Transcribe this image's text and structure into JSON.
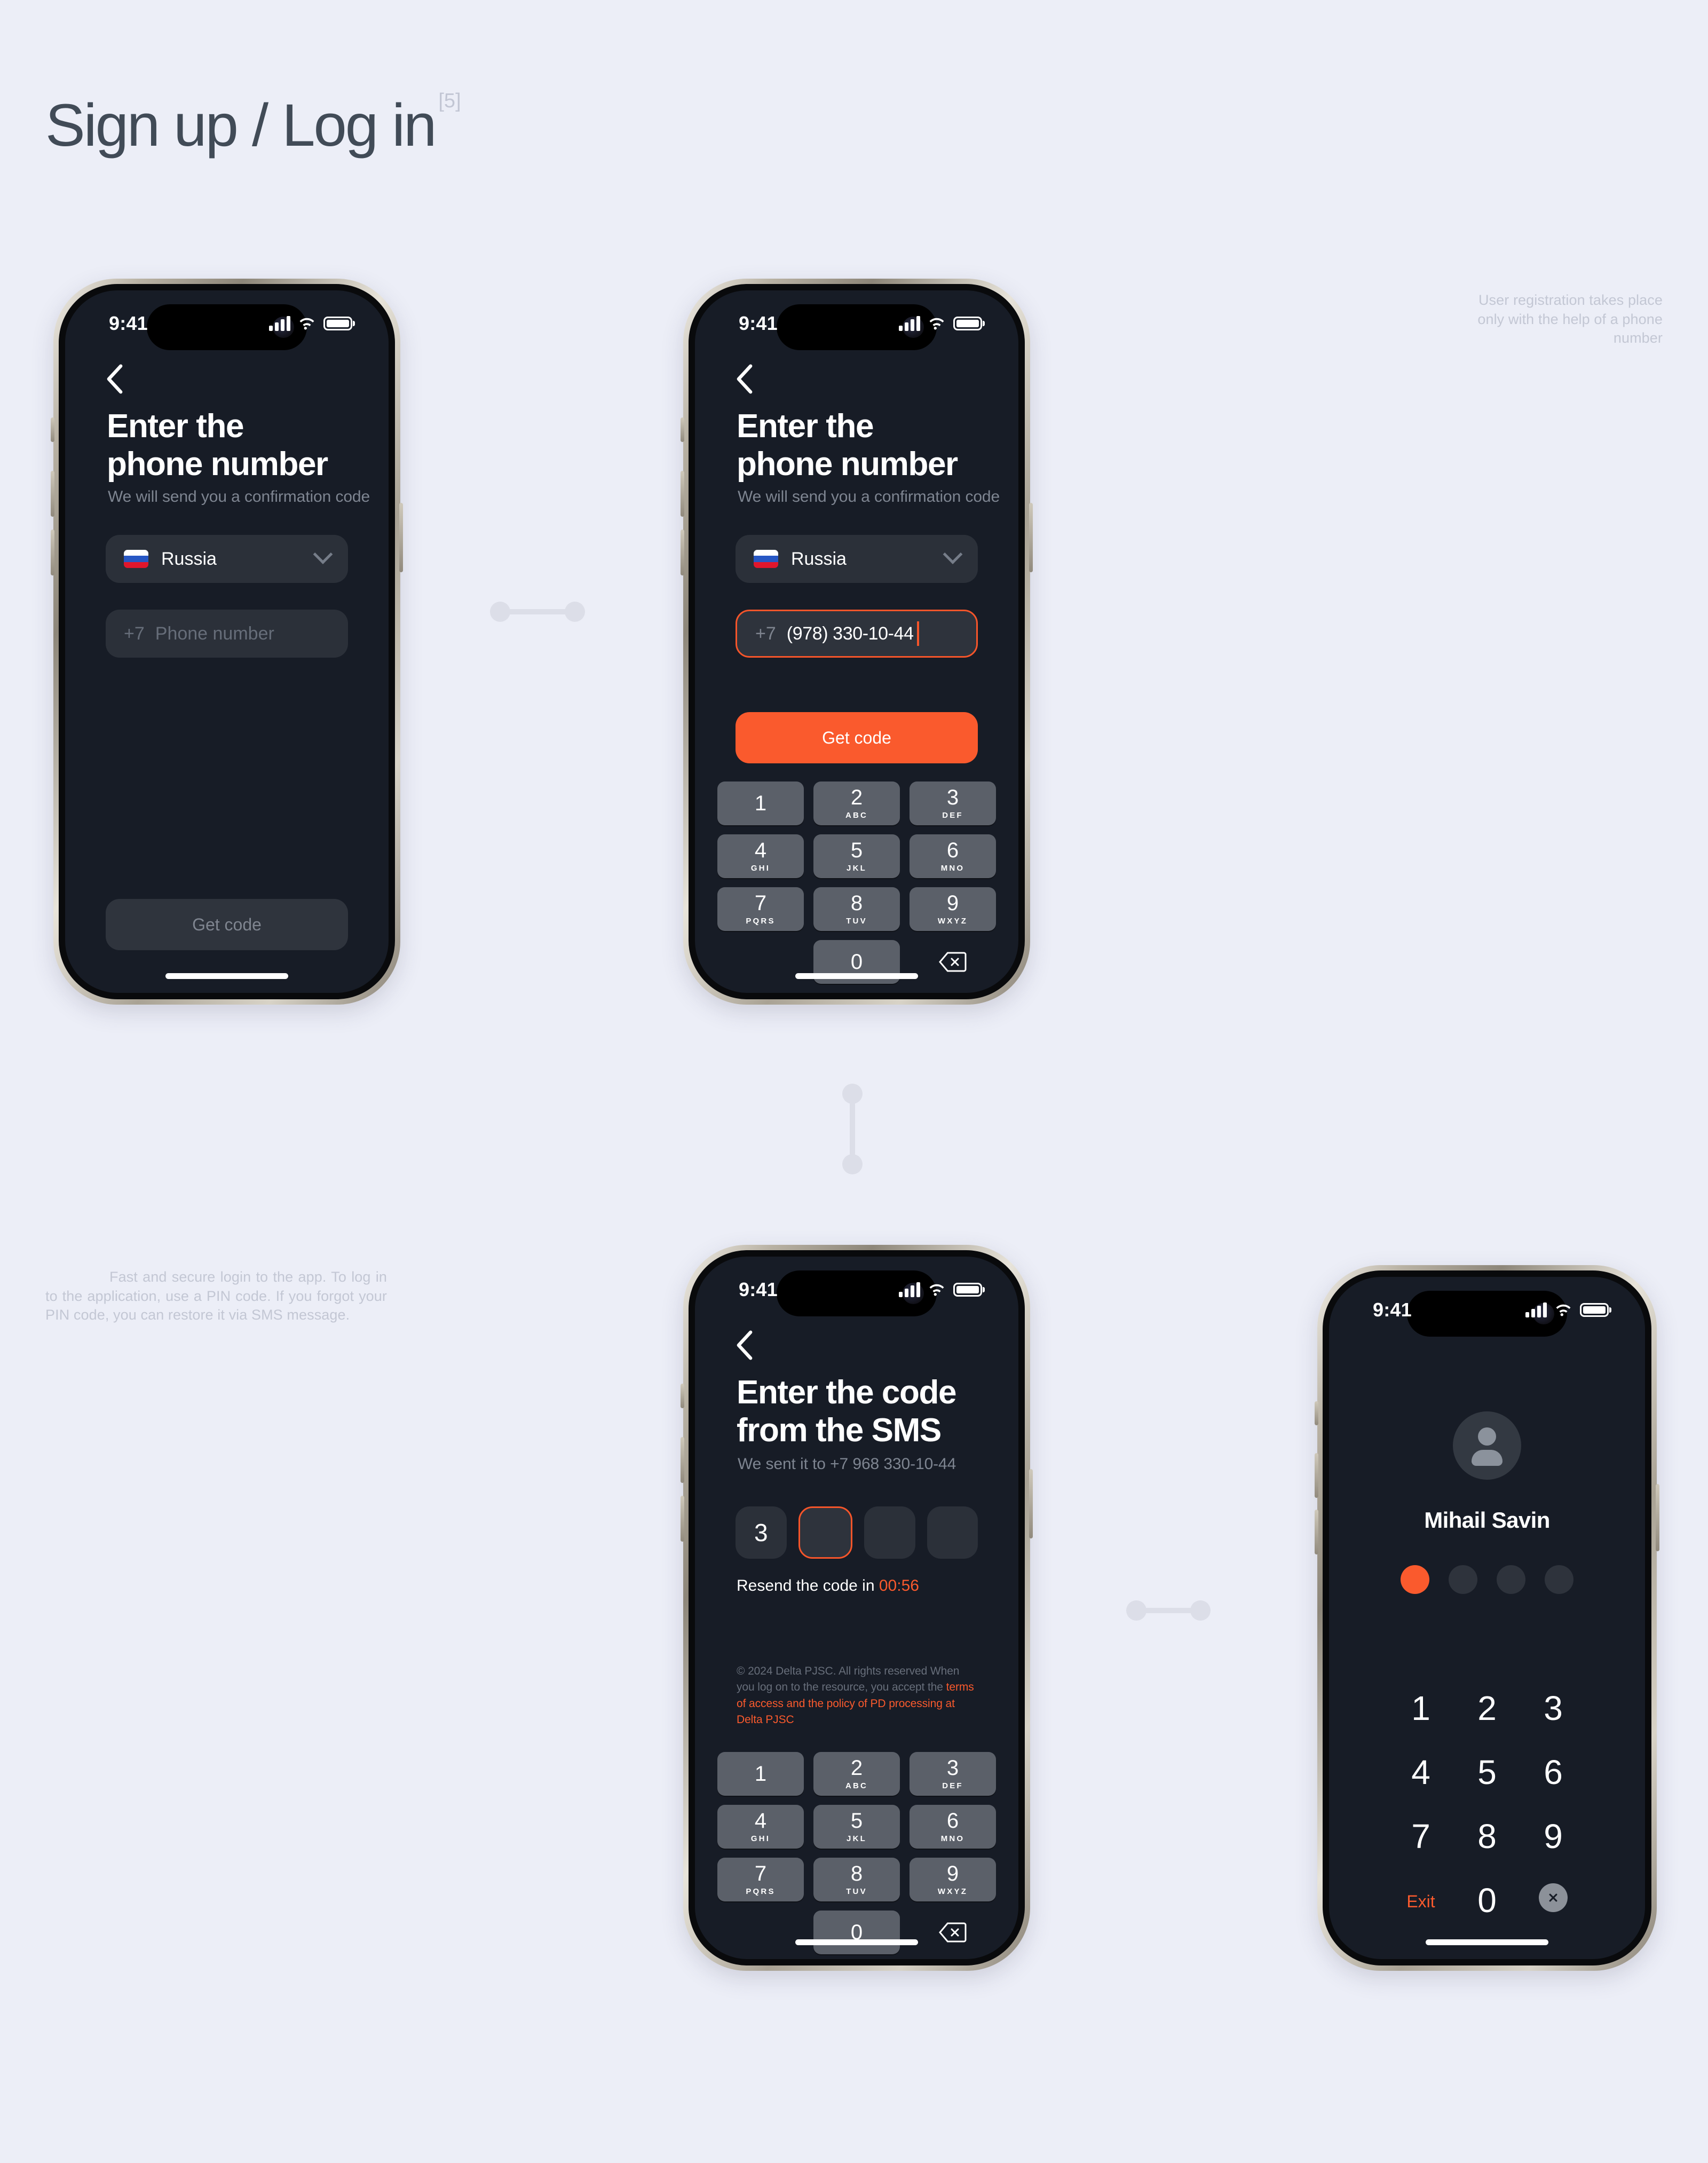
{
  "page": {
    "title": "Sign up / Log in",
    "title_superscript": "[5]",
    "background_color": "#eceef7",
    "accent_color": "#fa5a2d",
    "screen_background": "#171c26"
  },
  "annotations": {
    "top_right": "User registration takes place only with the help of a phone number",
    "bottom_left": "Fast and secure login to the app. To log in to the application, use a PIN code. If you forgot your PIN code, you can restore it via SMS message."
  },
  "status_bar": {
    "time": "9:41",
    "signal_icon": "cellular-bars-icon",
    "wifi_icon": "wifi-icon",
    "battery_icon": "battery-icon"
  },
  "keypad": {
    "keys": [
      {
        "num": "1",
        "letters": ""
      },
      {
        "num": "2",
        "letters": "ABC"
      },
      {
        "num": "3",
        "letters": "DEF"
      },
      {
        "num": "4",
        "letters": "GHI"
      },
      {
        "num": "5",
        "letters": "JKL"
      },
      {
        "num": "6",
        "letters": "MNO"
      },
      {
        "num": "7",
        "letters": "PQRS"
      },
      {
        "num": "8",
        "letters": "TUV"
      },
      {
        "num": "9",
        "letters": "WXYZ"
      },
      {
        "num": "0",
        "letters": ""
      }
    ],
    "delete_icon": "backspace-icon"
  },
  "screen1": {
    "name": "enter-phone-empty",
    "back_icon": "back-chevron-icon",
    "heading_line1": "Enter the",
    "heading_line2": "phone number",
    "subtitle": "We will send you a confirmation code",
    "country": {
      "label": "Russia",
      "flag": "russia-flag-icon",
      "chevron": "chevron-down-icon"
    },
    "phone_field": {
      "prefix": "+7",
      "placeholder": "Phone number",
      "value": ""
    },
    "cta": {
      "label": "Get code",
      "state": "disabled"
    }
  },
  "screen2": {
    "name": "enter-phone-filled",
    "back_icon": "back-chevron-icon",
    "heading_line1": "Enter the",
    "heading_line2": "phone number",
    "subtitle": "We will send you a confirmation code",
    "country": {
      "label": "Russia",
      "flag": "russia-flag-icon",
      "chevron": "chevron-down-icon"
    },
    "phone_field": {
      "prefix": "+7",
      "value": "(978) 330-10-44"
    },
    "cta": {
      "label": "Get code",
      "state": "enabled"
    }
  },
  "screen3": {
    "name": "enter-sms-code",
    "back_icon": "back-chevron-icon",
    "heading_line1": "Enter the code",
    "heading_line2": "from the SMS",
    "subtitle": "We sent it to +7 968 330-10-44",
    "otp": {
      "values": [
        "3",
        "",
        "",
        ""
      ],
      "focused_index": 1
    },
    "resend_label": "Resend the code in",
    "resend_timer": "00:56",
    "legal_text": "© 2024 Delta PJSC. All rights reserved When you log on to the resource, you accept the ",
    "legal_link": "terms of access and the policy of PD processing at Delta PJSC"
  },
  "screen4": {
    "name": "pin-lock",
    "avatar_icon": "user-avatar-icon",
    "user_name": "Mihail Savin",
    "pin_dots": [
      true,
      false,
      false,
      false
    ],
    "pad": [
      [
        "1",
        "2",
        "3"
      ],
      [
        "4",
        "5",
        "6"
      ],
      [
        "7",
        "8",
        "9"
      ]
    ],
    "exit_label": "Exit",
    "zero_label": "0",
    "delete_icon": "close-x-icon"
  }
}
